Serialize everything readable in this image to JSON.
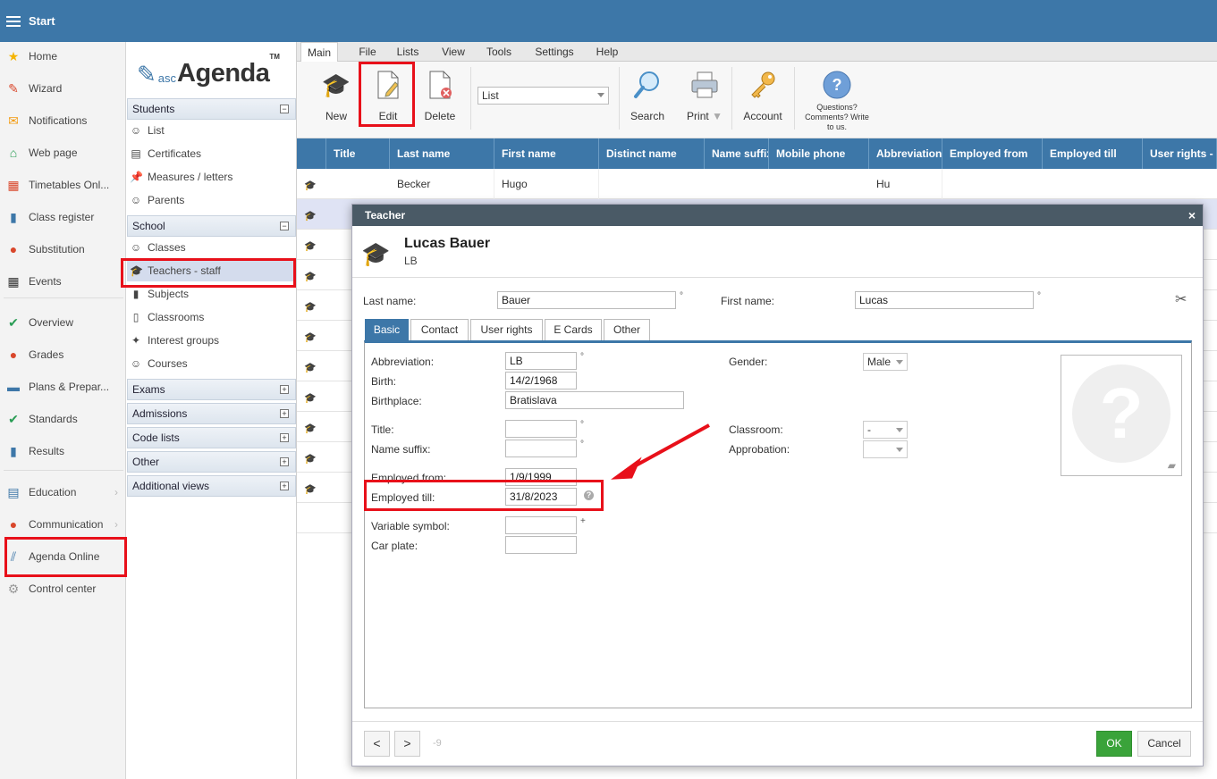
{
  "topbar": {
    "title": "Start"
  },
  "left_nav": {
    "items": [
      {
        "label": "Home",
        "icon": "star-icon",
        "glyph": "★",
        "color": "#f5b400"
      },
      {
        "label": "Wizard",
        "icon": "wand-icon",
        "glyph": "✎",
        "color": "#d9472b"
      },
      {
        "label": "Notifications",
        "icon": "envelope-icon",
        "glyph": "✉",
        "color": "#f39c12"
      },
      {
        "label": "Web page",
        "icon": "house-icon",
        "glyph": "⌂",
        "color": "#2a9d55"
      },
      {
        "label": "Timetables Onl...",
        "icon": "calendar-icon",
        "glyph": "▦",
        "color": "#d9472b"
      },
      {
        "label": "Class register",
        "icon": "book-icon",
        "glyph": "▮",
        "color": "#3d77a8"
      },
      {
        "label": "Substitution",
        "icon": "person-icon",
        "glyph": "●",
        "color": "#d9472b"
      },
      {
        "label": "Events",
        "icon": "events-calendar-icon",
        "glyph": "▦",
        "color": "#333"
      },
      {
        "label": "Overview",
        "icon": "check-circle-icon",
        "glyph": "✔",
        "color": "#2a9d55"
      },
      {
        "label": "Grades",
        "icon": "grades-icon",
        "glyph": "●",
        "color": "#d9472b"
      },
      {
        "label": "Plans & Prepar...",
        "icon": "briefcase-icon",
        "glyph": "▬",
        "color": "#3d77a8"
      },
      {
        "label": "Standards",
        "icon": "shield-check-icon",
        "glyph": "✔",
        "color": "#2a9d55"
      },
      {
        "label": "Results",
        "icon": "bar-chart-icon",
        "glyph": "▮",
        "color": "#3d77a8"
      },
      {
        "label": "Education",
        "icon": "open-book-icon",
        "glyph": "▤",
        "color": "#3d77a8"
      },
      {
        "label": "Communication",
        "icon": "chat-icon",
        "glyph": "●",
        "color": "#d9472b"
      },
      {
        "label": "Agenda Online",
        "icon": "agenda-online-icon",
        "glyph": "⫽",
        "color": "#3d77a8"
      },
      {
        "label": "Control center",
        "icon": "gear-icon",
        "glyph": "⚙",
        "color": "#999"
      }
    ]
  },
  "logo": {
    "small": "asc",
    "big": "Agenda",
    "tm": "TM"
  },
  "sec_nav": {
    "students": {
      "title": "Students",
      "toggle": "−",
      "items": [
        {
          "label": "List",
          "glyph": "☺"
        },
        {
          "label": "Certificates",
          "glyph": "▤"
        },
        {
          "label": "Measures / letters",
          "glyph": "📌"
        },
        {
          "label": "Parents",
          "glyph": "☺"
        }
      ]
    },
    "school": {
      "title": "School",
      "toggle": "−",
      "items": [
        {
          "label": "Classes",
          "glyph": "☺"
        },
        {
          "label": "Teachers - staff",
          "glyph": "🎓"
        },
        {
          "label": "Subjects",
          "glyph": "▮"
        },
        {
          "label": "Classrooms",
          "glyph": "▯"
        },
        {
          "label": "Interest groups",
          "glyph": "✦"
        },
        {
          "label": "Courses",
          "glyph": "☺"
        }
      ]
    },
    "collapsed": [
      {
        "title": "Exams",
        "toggle": "+"
      },
      {
        "title": "Admissions",
        "toggle": "+"
      },
      {
        "title": "Code lists",
        "toggle": "+"
      },
      {
        "title": "Other",
        "toggle": "+"
      },
      {
        "title": "Additional views",
        "toggle": "+"
      }
    ]
  },
  "menubar": [
    "Main",
    "File",
    "Lists",
    "View",
    "Tools",
    "Settings",
    "Help"
  ],
  "toolbar": {
    "new": "New",
    "edit": "Edit",
    "delete": "Delete",
    "view_select": "List",
    "search": "Search",
    "print": "Print",
    "account": "Account",
    "help_text": "Questions? Comments? Write to us."
  },
  "grid": {
    "columns": [
      "Title",
      "Last name",
      "First name",
      "Distinct name",
      "Name suffix",
      "Mobile phone",
      "Abbreviation",
      "Employed from",
      "Employed till",
      "User rights -"
    ],
    "first_row": {
      "title": "",
      "last_name": "Becker",
      "first_name": "Hugo",
      "abbreviation": "Hu"
    }
  },
  "dialog": {
    "title": "Teacher",
    "close": "×",
    "name": "Lucas Bauer",
    "abbr": "LB",
    "last_name_label": "Last name:",
    "last_name": "Bauer",
    "first_name_label": "First name:",
    "first_name": "Lucas",
    "degree_mark": "°",
    "tabs": [
      "Basic",
      "Contact",
      "User rights",
      "E Cards",
      "Other"
    ],
    "fields": {
      "abbreviation_label": "Abbreviation:",
      "abbreviation": "LB",
      "birth_label": "Birth:",
      "birth": "14/2/1968",
      "birthplace_label": "Birthplace:",
      "birthplace": "Bratislava",
      "title_label": "Title:",
      "title": "",
      "name_suffix_label": "Name suffix:",
      "name_suffix": "",
      "employed_from_label": "Employed from:",
      "employed_from": "1/9/1999",
      "employed_till_label": "Employed till:",
      "employed_till": "31/8/2023",
      "variable_symbol_label": "Variable symbol:",
      "variable_symbol": "",
      "car_plate_label": "Car plate:",
      "car_plate": "",
      "gender_label": "Gender:",
      "gender": "Male",
      "classroom_label": "Classroom:",
      "classroom": "-",
      "approbation_label": "Approbation:",
      "approbation": "",
      "plus_mark": "+"
    },
    "footer": {
      "prev": "<",
      "next": ">",
      "counter": "-9",
      "ok": "OK",
      "cancel": "Cancel"
    }
  }
}
